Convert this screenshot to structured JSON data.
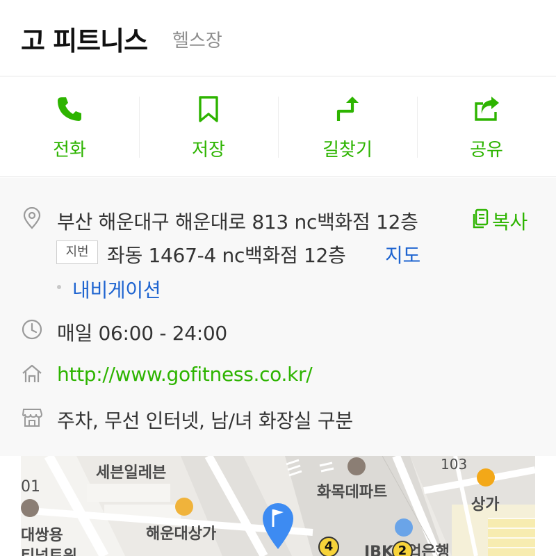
{
  "header": {
    "title": "고 피트니스",
    "category": "헬스장"
  },
  "actions": [
    {
      "label": "전화",
      "icon": "phone-icon"
    },
    {
      "label": "저장",
      "icon": "bookmark-icon"
    },
    {
      "label": "길찾기",
      "icon": "directions-icon"
    },
    {
      "label": "공유",
      "icon": "share-icon"
    }
  ],
  "info": {
    "address": "부산 해운대구 해운대로 813 nc백화점 12층",
    "copy_label": "복사",
    "lot_badge": "지번",
    "lot_address": "좌동 1467-4 nc백화점 12층",
    "map_link": "지도",
    "navigation_link": "내비게이션",
    "hours": "매일 06:00 - 24:00",
    "website": "http://www.gofitness.co.kr/",
    "amenities": "주차, 무선 인터넷, 남/녀 화장실 구분"
  },
  "map": {
    "labels": {
      "seven_eleven": "세븐일레븐",
      "hwamok_department": "화목데파트",
      "shop": "상가",
      "haeundae_shops": "해운대상가",
      "daessangyong": "대쌍용",
      "num_101": "01",
      "num_103": "103",
      "ibk_bank": "IBK기업은행",
      "partial_tower": "티넘트워",
      "marker_4": "4",
      "marker_2": "2"
    }
  },
  "colors": {
    "accent_green": "#2db400",
    "link_blue": "#1e64d0",
    "marker_blue": "#3d8bf2"
  }
}
